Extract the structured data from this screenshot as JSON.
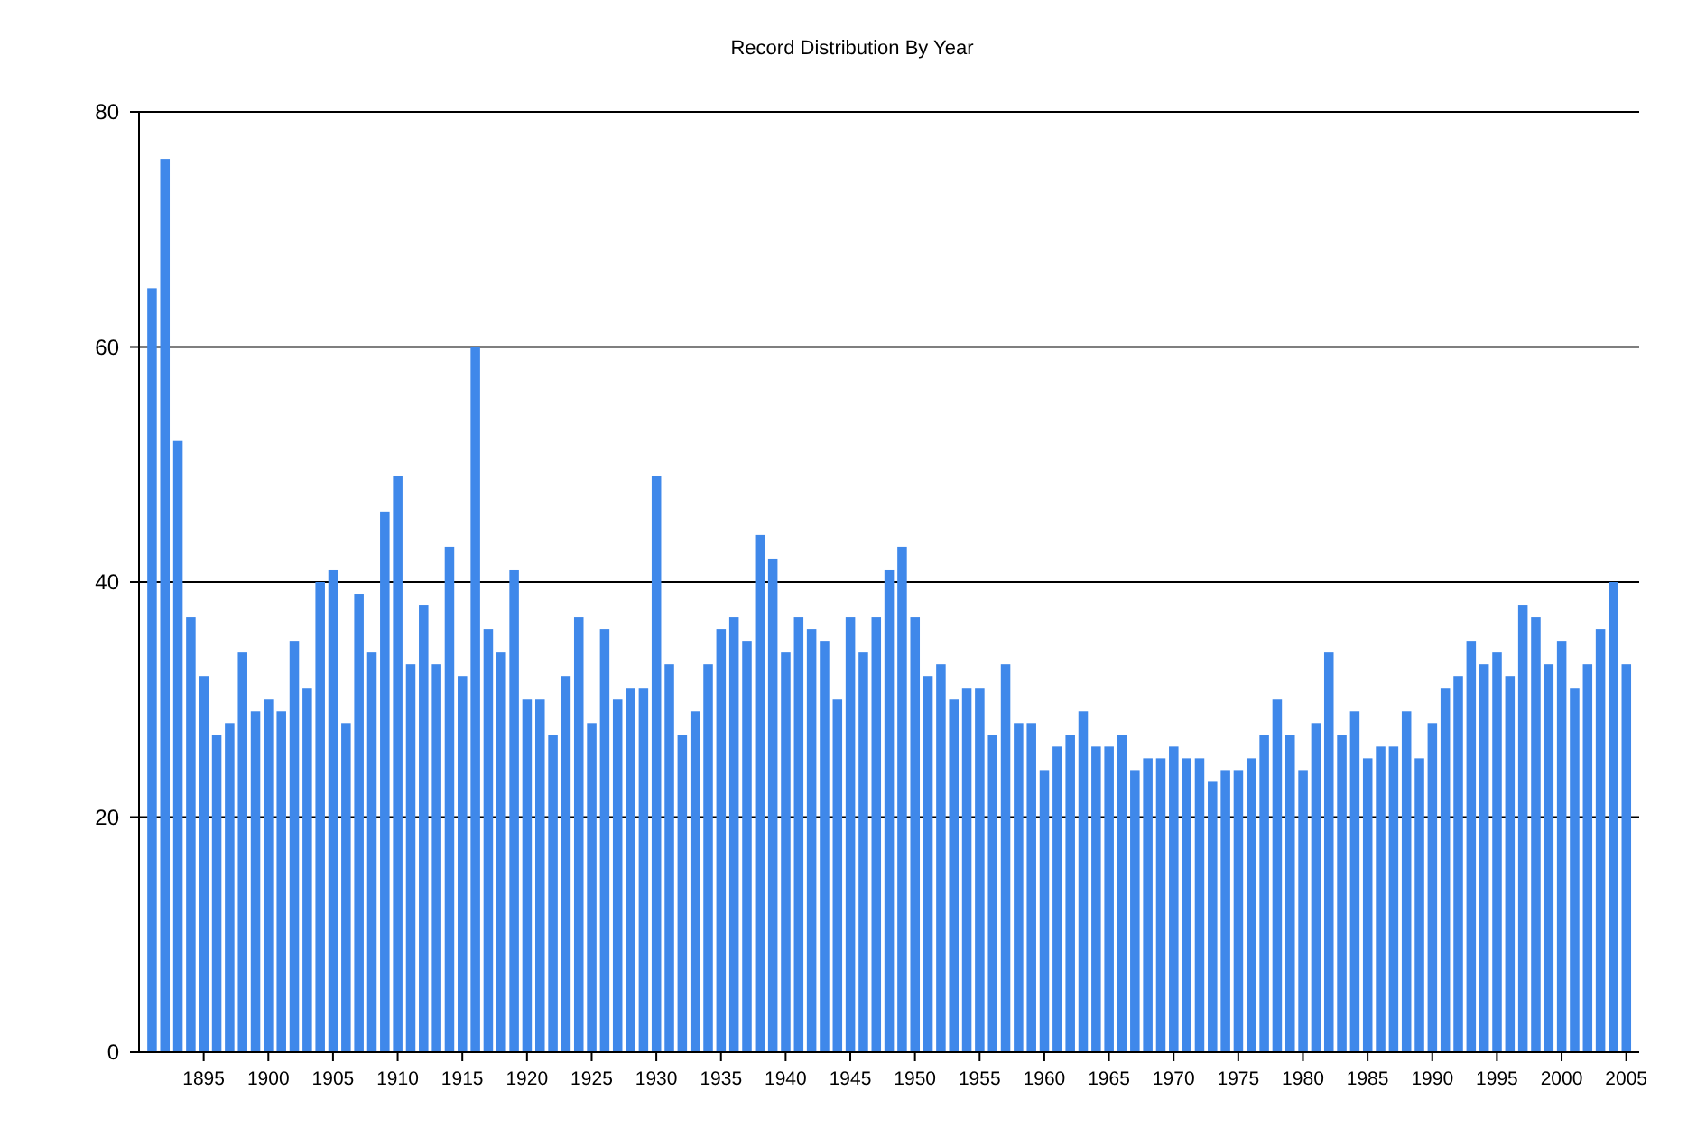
{
  "chart_data": {
    "type": "bar",
    "title": "Record Distribution By Year",
    "x": [
      1891,
      1892,
      1893,
      1894,
      1895,
      1896,
      1897,
      1898,
      1899,
      1900,
      1901,
      1902,
      1903,
      1904,
      1905,
      1906,
      1907,
      1908,
      1909,
      1910,
      1911,
      1912,
      1913,
      1914,
      1915,
      1916,
      1917,
      1918,
      1919,
      1920,
      1921,
      1922,
      1923,
      1924,
      1925,
      1926,
      1927,
      1928,
      1929,
      1930,
      1931,
      1932,
      1933,
      1934,
      1935,
      1936,
      1937,
      1938,
      1939,
      1940,
      1941,
      1942,
      1943,
      1944,
      1945,
      1946,
      1947,
      1948,
      1949,
      1950,
      1951,
      1952,
      1953,
      1954,
      1955,
      1956,
      1957,
      1958,
      1959,
      1960,
      1961,
      1962,
      1963,
      1964,
      1965,
      1966,
      1967,
      1968,
      1969,
      1970,
      1971,
      1972,
      1973,
      1974,
      1975,
      1976,
      1977,
      1978,
      1979,
      1980,
      1981,
      1982,
      1983,
      1984,
      1985,
      1986,
      1987,
      1988,
      1989,
      1990,
      1991,
      1992,
      1993,
      1994,
      1995,
      1996,
      1997,
      1998,
      1999,
      2000,
      2001,
      2002,
      2003,
      2004,
      2005
    ],
    "grid": true,
    "xlim": [
      1890,
      2006
    ],
    "series": [
      {
        "color": "#3f88ea",
        "values": [
          65,
          76,
          52,
          37,
          32,
          27,
          28,
          34,
          29,
          30,
          29,
          35,
          31,
          40,
          41,
          28,
          39,
          34,
          46,
          49,
          33,
          38,
          33,
          43,
          32,
          60,
          36,
          34,
          41,
          30,
          30,
          27,
          32,
          37,
          28,
          36,
          30,
          31,
          31,
          49,
          33,
          27,
          29,
          33,
          36,
          37,
          35,
          44,
          42,
          34,
          37,
          36,
          35,
          30,
          37,
          34,
          37,
          41,
          43,
          37,
          32,
          33,
          30,
          31,
          31,
          27,
          33,
          28,
          28,
          24,
          26,
          27,
          29,
          26,
          26,
          27,
          24,
          25,
          25,
          26,
          25,
          25,
          23,
          24,
          24,
          25,
          27,
          30,
          27,
          24,
          28,
          34,
          27,
          29,
          25,
          26,
          26,
          29,
          25,
          28,
          31,
          32,
          35,
          33,
          34,
          32,
          38,
          37,
          33,
          35,
          31,
          33,
          36,
          40,
          33
        ]
      }
    ],
    "ylim": [
      0,
      80
    ],
    "yticks": [
      0,
      20,
      40,
      60,
      80
    ],
    "xticks": [
      1895,
      1900,
      1905,
      1910,
      1915,
      1920,
      1925,
      1930,
      1935,
      1940,
      1945,
      1950,
      1955,
      1960,
      1965,
      1970,
      1975,
      1980,
      1985,
      1990,
      1995,
      2000,
      2005
    ]
  }
}
